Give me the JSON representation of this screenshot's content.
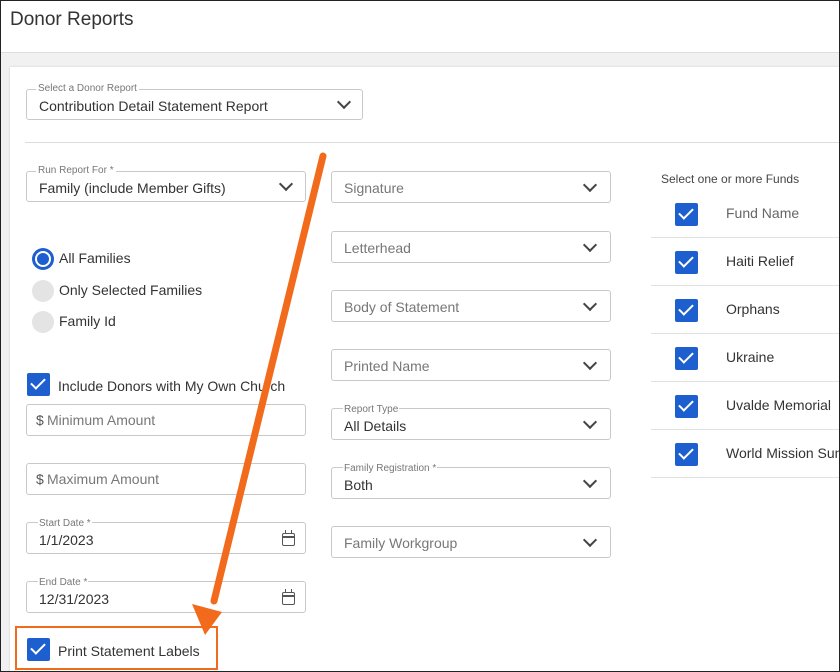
{
  "page": {
    "title": "Donor Reports"
  },
  "report_select": {
    "label": "Select a Donor Report",
    "value": "Contribution Detail Statement Report"
  },
  "run_for": {
    "label": "Run Report For *",
    "value": "Family (include Member Gifts)"
  },
  "family_options": [
    {
      "label": "All Families",
      "selected": true
    },
    {
      "label": "Only Selected Families",
      "selected": false
    },
    {
      "label": "Family Id",
      "selected": false
    }
  ],
  "include_donors": {
    "label": "Include Donors with My Own Church",
    "checked": true
  },
  "minimum_amount": {
    "prefix": "$",
    "placeholder": "Minimum Amount"
  },
  "maximum_amount": {
    "prefix": "$",
    "placeholder": "Maximum Amount"
  },
  "start_date": {
    "label": "Start Date *",
    "value": "1/1/2023"
  },
  "end_date": {
    "label": "End Date *",
    "value": "12/31/2023"
  },
  "print_labels": {
    "label": "Print Statement Labels",
    "checked": true
  },
  "middle": {
    "signature": "Signature",
    "letterhead": "Letterhead",
    "body": "Body of Statement",
    "printed_name": "Printed Name",
    "report_type": {
      "label": "Report Type",
      "value": "All Details"
    },
    "family_registration": {
      "label": "Family Registration *",
      "value": "Both"
    },
    "family_workgroup": "Family Workgroup"
  },
  "funds": {
    "label": "Select one or more Funds",
    "header": "Fund Name",
    "items": [
      "Haiti Relief",
      "Orphans",
      "Ukraine",
      "Uvalde Memorial",
      "World Mission Sunday"
    ]
  },
  "colors": {
    "accent": "#1e5fcf",
    "annotation": "#f26a1b"
  }
}
